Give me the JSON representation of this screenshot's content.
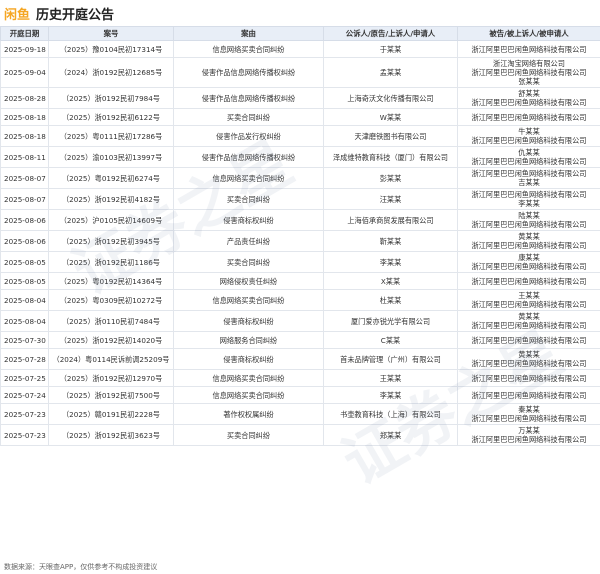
{
  "header": {
    "brand": "闲鱼",
    "title": "历史开庭公告"
  },
  "table": {
    "columns": [
      "开庭日期",
      "案号",
      "案由",
      "公诉人/原告/上诉人/申请人",
      "被告/被上诉人/被申请人"
    ],
    "rows": [
      {
        "date": "2025-09-18",
        "case_no": "（2025）豫0104民初17314号",
        "cause": "信息网络买卖合同纠纷",
        "plaintiff": "于某某",
        "defendants": [
          "浙江阿里巴巴闲鱼网络科技有限公司"
        ]
      },
      {
        "date": "2025-09-04",
        "case_no": "（2024）浙0192民初12685号",
        "cause": "侵害作品信息网络传播权纠纷",
        "plaintiff": "孟某某",
        "defendants": [
          "浙江淘宝网络有限公司",
          "浙江阿里巴巴闲鱼网络科技有限公司",
          "张某某"
        ]
      },
      {
        "date": "2025-08-28",
        "case_no": "（2025）浙0192民初7984号",
        "cause": "侵害作品信息网络传播权纠纷",
        "plaintiff": "上海奇沃文化传播有限公司",
        "defendants": [
          "舒某某",
          "浙江阿里巴巴闲鱼网络科技有限公司"
        ]
      },
      {
        "date": "2025-08-18",
        "case_no": "（2025）浙0192民初6122号",
        "cause": "买卖合同纠纷",
        "plaintiff": "W某某",
        "defendants": [
          "浙江阿里巴巴闲鱼网络科技有限公司"
        ]
      },
      {
        "date": "2025-08-18",
        "case_no": "（2025）粤0111民初17286号",
        "cause": "侵害作品发行权纠纷",
        "plaintiff": "天津磨铁图书有限公司",
        "defendants": [
          "牛某某",
          "浙江阿里巴巴闲鱼网络科技有限公司"
        ]
      },
      {
        "date": "2025-08-11",
        "case_no": "（2025）渝0103民初13997号",
        "cause": "侵害作品信息网络传播权纠纷",
        "plaintiff": "泽成维特教育科技（厦门）有限公司",
        "defendants": [
          "仇某某",
          "浙江阿里巴巴闲鱼网络科技有限公司"
        ]
      },
      {
        "date": "2025-08-07",
        "case_no": "（2025）粤0192民初6274号",
        "cause": "信息网络买卖合同纠纷",
        "plaintiff": "彭某某",
        "defendants": [
          "浙江阿里巴巴闲鱼网络科技有限公司",
          "吉某某"
        ]
      },
      {
        "date": "2025-08-07",
        "case_no": "（2025）浙0192民初4182号",
        "cause": "买卖合同纠纷",
        "plaintiff": "汪某某",
        "defendants": [
          "浙江阿里巴巴闲鱼网络科技有限公司",
          "李某某"
        ]
      },
      {
        "date": "2025-08-06",
        "case_no": "（2025）沪0105民初14609号",
        "cause": "侵害商标权纠纷",
        "plaintiff": "上海佰承商贸发展有限公司",
        "defendants": [
          "陆某某",
          "浙江阿里巴巴闲鱼网络科技有限公司"
        ]
      },
      {
        "date": "2025-08-06",
        "case_no": "（2025）浙0192民初3945号",
        "cause": "产品责任纠纷",
        "plaintiff": "靳某某",
        "defendants": [
          "黄某某",
          "浙江阿里巴巴闲鱼网络科技有限公司"
        ]
      },
      {
        "date": "2025-08-05",
        "case_no": "（2025）浙0192民初1186号",
        "cause": "买卖合同纠纷",
        "plaintiff": "李某某",
        "defendants": [
          "康某某",
          "浙江阿里巴巴闲鱼网络科技有限公司"
        ]
      },
      {
        "date": "2025-08-05",
        "case_no": "（2025）粤0192民初14364号",
        "cause": "网络侵权责任纠纷",
        "plaintiff": "X某某",
        "defendants": [
          "浙江阿里巴巴闲鱼网络科技有限公司"
        ]
      },
      {
        "date": "2025-08-04",
        "case_no": "（2025）粤0309民初10272号",
        "cause": "信息网络买卖合同纠纷",
        "plaintiff": "杜某某",
        "defendants": [
          "王某某",
          "浙江阿里巴巴闲鱼网络科技有限公司"
        ]
      },
      {
        "date": "2025-08-04",
        "case_no": "（2025）浙0110民初7484号",
        "cause": "侵害商标权纠纷",
        "plaintiff": "厦门爱亦锐光学有限公司",
        "defendants": [
          "黄某某",
          "浙江阿里巴巴闲鱼网络科技有限公司"
        ]
      },
      {
        "date": "2025-07-30",
        "case_no": "（2025）浙0192民初14020号",
        "cause": "网络服务合同纠纷",
        "plaintiff": "C某某",
        "defendants": [
          "浙江阿里巴巴闲鱼网络科技有限公司"
        ]
      },
      {
        "date": "2025-07-28",
        "case_no": "（2024）粤0114民诉前调25209号",
        "cause": "侵害商标权纠纷",
        "plaintiff": "首未品牌管理（广州）有限公司",
        "defendants": [
          "黄某某",
          "浙江阿里巴巴闲鱼网络科技有限公司"
        ]
      },
      {
        "date": "2025-07-25",
        "case_no": "（2025）浙0192民初12970号",
        "cause": "信息网络买卖合同纠纷",
        "plaintiff": "王某某",
        "defendants": [
          "浙江阿里巴巴闲鱼网络科技有限公司"
        ]
      },
      {
        "date": "2025-07-24",
        "case_no": "（2025）浙0192民初7500号",
        "cause": "信息网络买卖合同纠纷",
        "plaintiff": "李某某",
        "defendants": [
          "浙江阿里巴巴闲鱼网络科技有限公司"
        ]
      },
      {
        "date": "2025-07-23",
        "case_no": "（2025）赣0191民初2228号",
        "cause": "著作权权属纠纷",
        "plaintiff": "书壶教育科技（上海）有限公司",
        "defendants": [
          "秦某某",
          "浙江阿里巴巴闲鱼网络科技有限公司"
        ]
      },
      {
        "date": "2025-07-23",
        "case_no": "（2025）浙0192民初3623号",
        "cause": "买卖合同纠纷",
        "plaintiff": "郑某某",
        "defendants": [
          "万某某",
          "浙江阿里巴巴闲鱼网络科技有限公司"
        ]
      }
    ]
  },
  "footer": {
    "text": "数据来源：天眼查APP，仅供参考不构成投资建议"
  },
  "watermark": {
    "text": "证券之星"
  },
  "colors": {
    "brand": "#f5a623",
    "header_bg": "#e8eef7"
  }
}
